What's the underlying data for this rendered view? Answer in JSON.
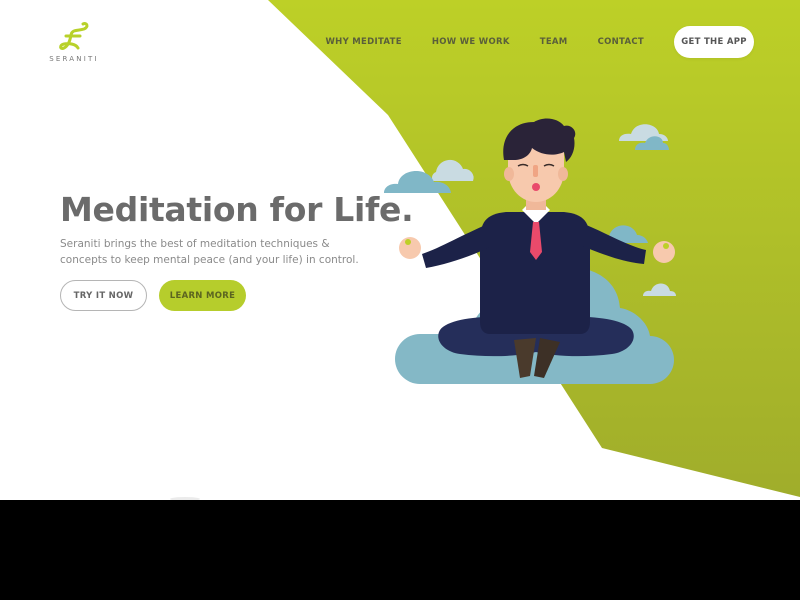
{
  "brand": {
    "name": "SERANITI",
    "accent_color": "#bccf27",
    "accent_dark": "#a0ad2b",
    "logo_icon": "infinity-s-icon"
  },
  "nav": {
    "items": [
      {
        "label": "WHY MEDITATE"
      },
      {
        "label": "HOW WE WORK"
      },
      {
        "label": "TEAM"
      },
      {
        "label": "CONTACT"
      }
    ],
    "cta_label": "GET THE APP"
  },
  "hero": {
    "title": "Meditation for Life.",
    "subtitle": "Seraniti brings the best of meditation techniques & concepts to keep mental peace (and your life) in control.",
    "primary_button": "TRY IT NOW",
    "secondary_button": "LEARN MORE",
    "illustration": "meditating-businessman-on-cloud"
  }
}
